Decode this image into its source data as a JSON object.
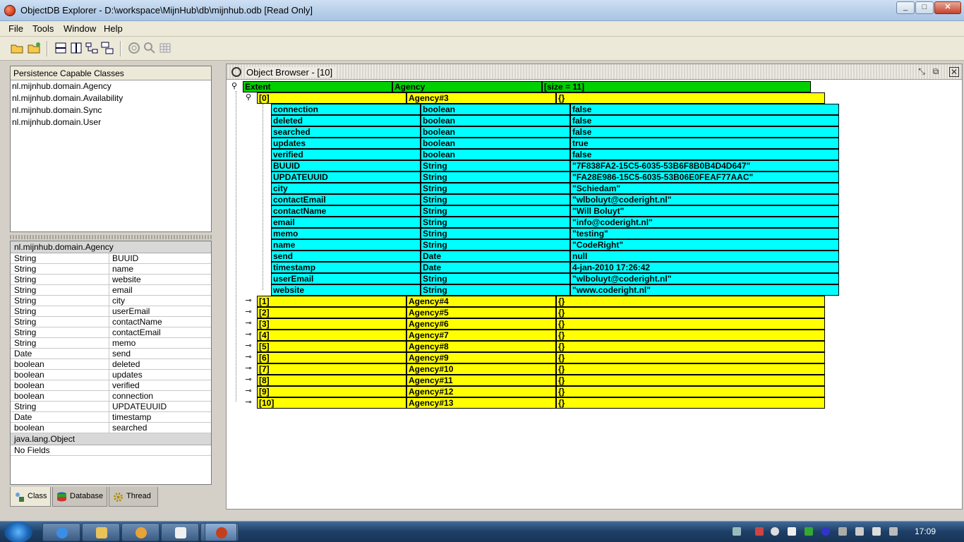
{
  "window": {
    "title": "ObjectDB Explorer - D:\\workspace\\MijnHub\\db\\mijnhub.odb [Read Only]"
  },
  "menu": [
    "File",
    "Tools",
    "Window",
    "Help"
  ],
  "toolbar": {
    "icons": [
      "open-icon",
      "open-recent-icon",
      "horizontal-split-icon",
      "vertical-split-icon",
      "tree-view-icon",
      "graph-view-icon",
      "query-icon",
      "find-icon",
      "table-view-icon"
    ]
  },
  "classes_panel": {
    "header": "Persistence Capable Classes",
    "items": [
      "nl.mijnhub.domain.Agency",
      "nl.mijnhub.domain.Availability",
      "nl.mijnhub.domain.Sync",
      "nl.mijnhub.domain.User"
    ]
  },
  "fields_panel": {
    "groups": [
      {
        "name": "nl.mijnhub.domain.Agency",
        "fields": [
          [
            "String",
            "BUUID"
          ],
          [
            "String",
            "name"
          ],
          [
            "String",
            "website"
          ],
          [
            "String",
            "email"
          ],
          [
            "String",
            "city"
          ],
          [
            "String",
            "userEmail"
          ],
          [
            "String",
            "contactName"
          ],
          [
            "String",
            "contactEmail"
          ],
          [
            "String",
            "memo"
          ],
          [
            "Date",
            "send"
          ],
          [
            "boolean",
            "deleted"
          ],
          [
            "boolean",
            "updates"
          ],
          [
            "boolean",
            "verified"
          ],
          [
            "boolean",
            "connection"
          ],
          [
            "String",
            "UPDATEUUID"
          ],
          [
            "Date",
            "timestamp"
          ],
          [
            "boolean",
            "searched"
          ]
        ]
      },
      {
        "name": "java.lang.Object",
        "note": "No Fields"
      }
    ]
  },
  "left_tabs": [
    "Class",
    "Database",
    "Thread"
  ],
  "object_browser": {
    "title": "Object Browser - [10]",
    "root": [
      "Extent",
      "Agency",
      "[size = 11]"
    ],
    "expanded": {
      "index": "[0]",
      "object": "Agency#3",
      "value": "{}",
      "fields": [
        [
          "connection",
          "boolean",
          "false"
        ],
        [
          "deleted",
          "boolean",
          "false"
        ],
        [
          "searched",
          "boolean",
          "false"
        ],
        [
          "updates",
          "boolean",
          "true"
        ],
        [
          "verified",
          "boolean",
          "false"
        ],
        [
          "BUUID",
          "String",
          "\"7F838FA2-15C5-6035-53B6F8B0B4D4D647\""
        ],
        [
          "UPDATEUUID",
          "String",
          "\"FA28E986-15C5-6035-53B06E0FEAF77AAC\""
        ],
        [
          "city",
          "String",
          "\"Schiedam\""
        ],
        [
          "contactEmail",
          "String",
          "\"wlboluyt@coderight.nl\""
        ],
        [
          "contactName",
          "String",
          "\"Will Boluyt\""
        ],
        [
          "email",
          "String",
          "\"info@coderight.nl\""
        ],
        [
          "memo",
          "String",
          "\"testing\""
        ],
        [
          "name",
          "String",
          "\"CodeRight\""
        ],
        [
          "send",
          "Date",
          "null"
        ],
        [
          "timestamp",
          "Date",
          "4-jan-2010 17:26:42"
        ],
        [
          "userEmail",
          "String",
          "\"wlboluyt@coderight.nl\""
        ],
        [
          "website",
          "String",
          "\"www.coderight.nl\""
        ]
      ]
    },
    "collapsed": [
      [
        "[1]",
        "Agency#4",
        "{}"
      ],
      [
        "[2]",
        "Agency#5",
        "{}"
      ],
      [
        "[3]",
        "Agency#6",
        "{}"
      ],
      [
        "[4]",
        "Agency#7",
        "{}"
      ],
      [
        "[5]",
        "Agency#8",
        "{}"
      ],
      [
        "[6]",
        "Agency#9",
        "{}"
      ],
      [
        "[7]",
        "Agency#10",
        "{}"
      ],
      [
        "[8]",
        "Agency#11",
        "{}"
      ],
      [
        "[9]",
        "Agency#12",
        "{}"
      ],
      [
        "[10]",
        "Agency#13",
        "{}"
      ]
    ]
  },
  "taskbar": {
    "clock": "17:09"
  },
  "colors": {
    "extent_row": "#00d000",
    "object_row": "#ffff00",
    "field_row": "#00ffff"
  }
}
